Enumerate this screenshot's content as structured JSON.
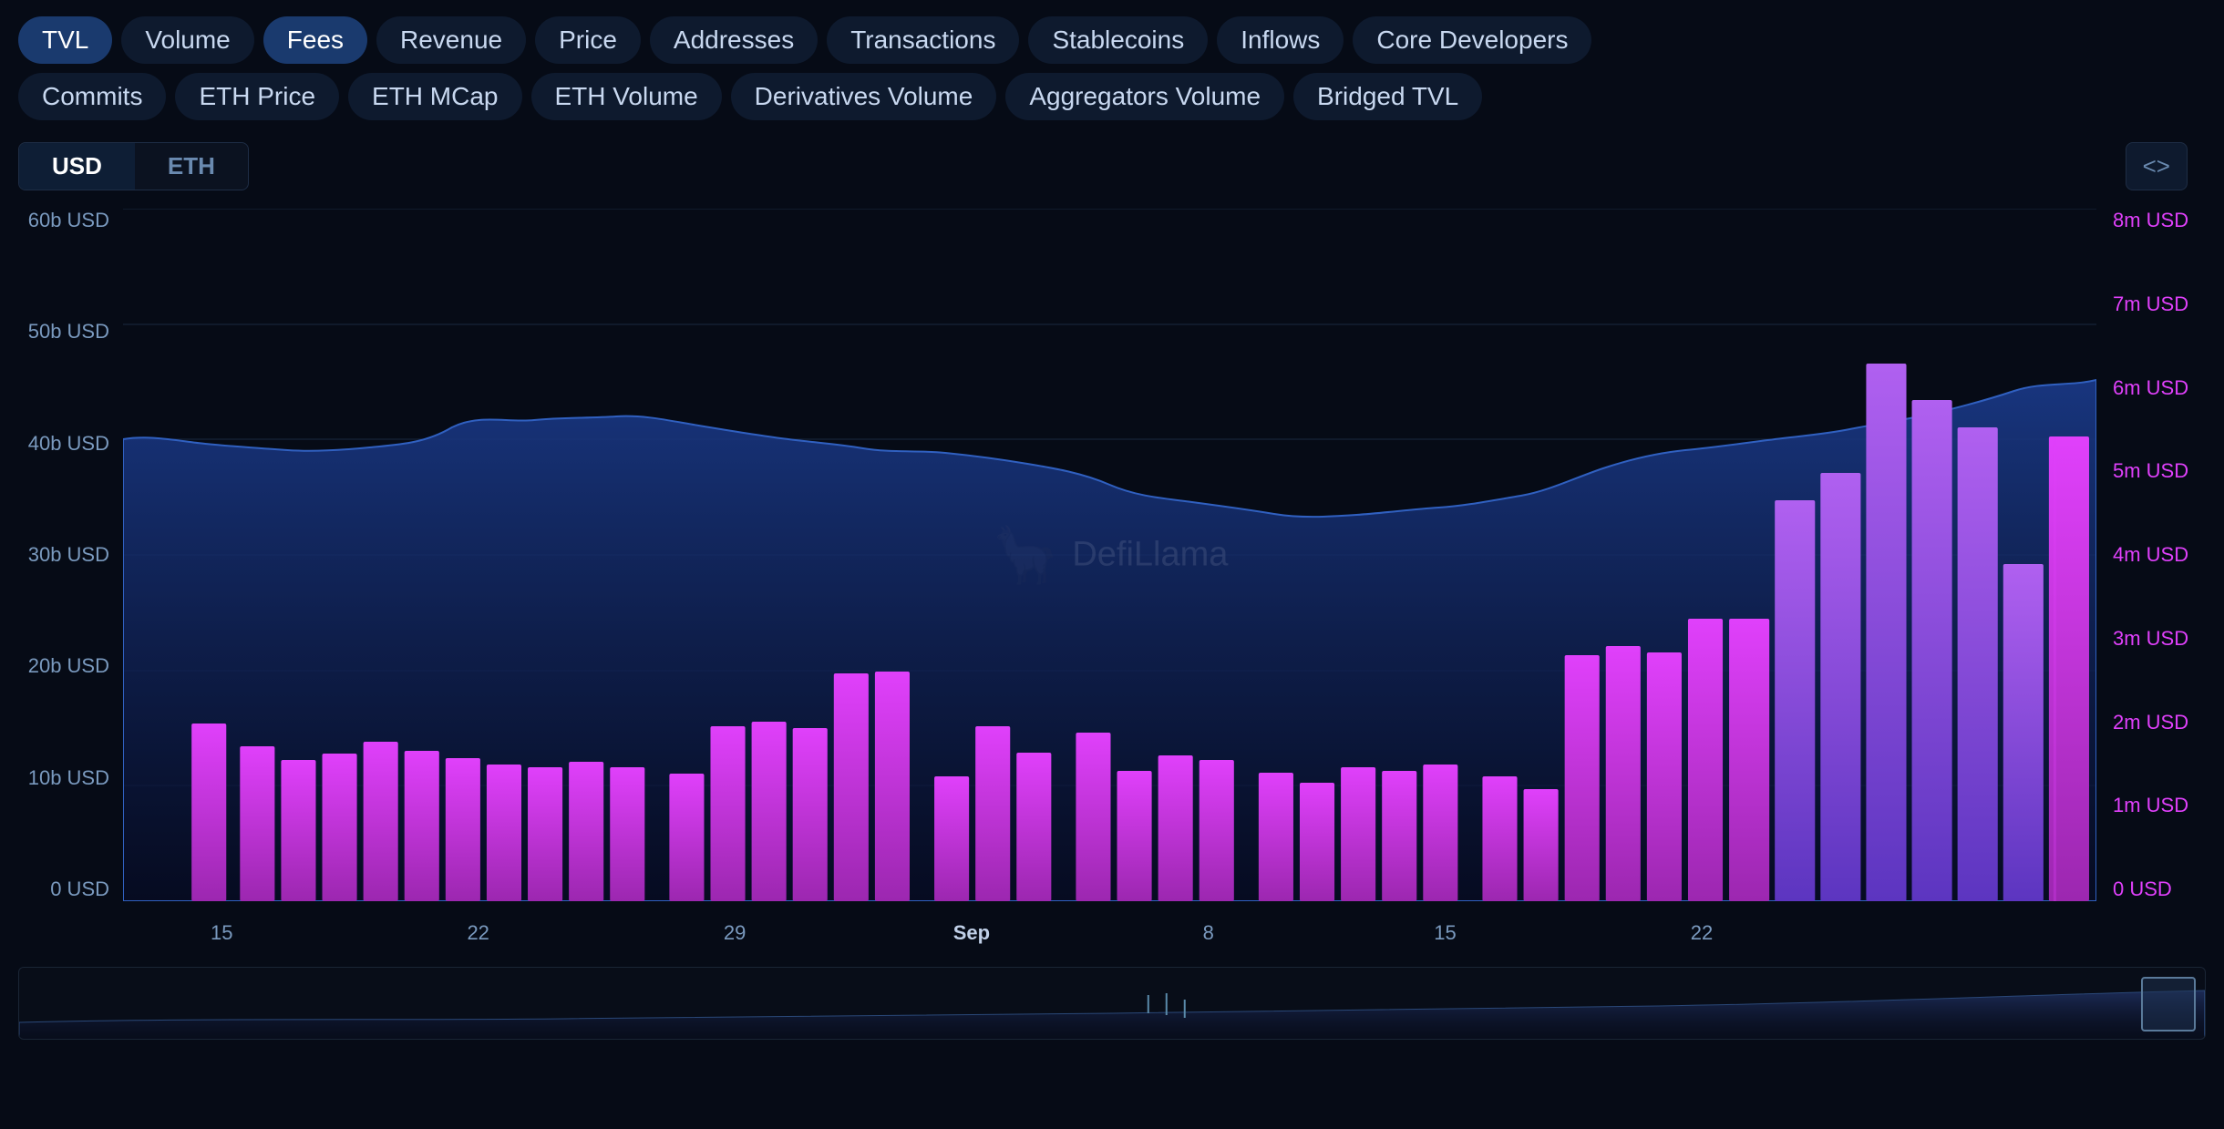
{
  "nav": {
    "row1": [
      {
        "label": "TVL",
        "active": true,
        "id": "tvl"
      },
      {
        "label": "Volume",
        "active": false,
        "id": "volume"
      },
      {
        "label": "Fees",
        "active": true,
        "id": "fees"
      },
      {
        "label": "Revenue",
        "active": false,
        "id": "revenue"
      },
      {
        "label": "Price",
        "active": false,
        "id": "price"
      },
      {
        "label": "Addresses",
        "active": false,
        "id": "addresses"
      },
      {
        "label": "Transactions",
        "active": false,
        "id": "transactions"
      },
      {
        "label": "Stablecoins",
        "active": false,
        "id": "stablecoins"
      },
      {
        "label": "Inflows",
        "active": false,
        "id": "inflows"
      },
      {
        "label": "Core Developers",
        "active": false,
        "id": "core-developers"
      }
    ],
    "row2": [
      {
        "label": "Commits",
        "active": false,
        "id": "commits"
      },
      {
        "label": "ETH Price",
        "active": false,
        "id": "eth-price"
      },
      {
        "label": "ETH MCap",
        "active": false,
        "id": "eth-mcap"
      },
      {
        "label": "ETH Volume",
        "active": false,
        "id": "eth-volume"
      },
      {
        "label": "Derivatives Volume",
        "active": false,
        "id": "derivatives-volume"
      },
      {
        "label": "Aggregators Volume",
        "active": false,
        "id": "aggregators-volume"
      },
      {
        "label": "Bridged TVL",
        "active": false,
        "id": "bridged-tvl"
      }
    ]
  },
  "currency": {
    "usd_label": "USD",
    "eth_label": "ETH",
    "active": "USD"
  },
  "embed_icon": "<>",
  "chart": {
    "watermark": "DefiLlama",
    "y_left_labels": [
      "60b USD",
      "50b USD",
      "40b USD",
      "30b USD",
      "20b USD",
      "10b USD",
      "0 USD"
    ],
    "y_right_labels": [
      "8m USD",
      "7m USD",
      "6m USD",
      "5m USD",
      "4m USD",
      "3m USD",
      "2m USD",
      "1m USD",
      "0 USD"
    ],
    "x_labels": [
      {
        "label": "15",
        "pct": 5
      },
      {
        "label": "22",
        "pct": 18
      },
      {
        "label": "29",
        "pct": 30
      },
      {
        "label": "Sep",
        "pct": 42,
        "bold": true
      },
      {
        "label": "8",
        "pct": 54
      },
      {
        "label": "15",
        "pct": 66
      },
      {
        "label": "22",
        "pct": 79
      }
    ]
  }
}
